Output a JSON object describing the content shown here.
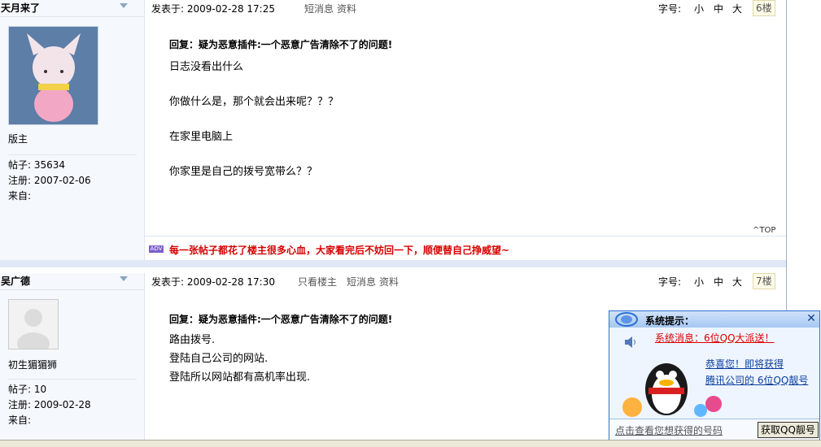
{
  "posts": [
    {
      "author": "天月来了",
      "rank": "版主",
      "stats": {
        "posts": "帖子: 35634",
        "reg": "注册:  2007-02-06",
        "from": "来自:"
      },
      "meta": {
        "posted": "发表于:  2009-02-28 17:25",
        "links": [
          "短消息",
          "资料"
        ]
      },
      "font": {
        "label": "字号:",
        "small": "小",
        "medium": "中",
        "large": "大"
      },
      "floor": "6楼",
      "reply_title": "回复：疑为恶意插件:一个恶意广告清除不了的问题!",
      "lines": [
        "日志没看出什么",
        "你做什么是，那个就会出来呢？？？",
        "在家里电脑上",
        "你家里是自己的拨号宽带么？？"
      ],
      "top": "TOP",
      "signature": "每一张帖子都花了楼主很多心血，大家看完后不妨回一下，顺便替自己挣威望~"
    },
    {
      "author": "吴广德",
      "rank": "初生猸猸狮",
      "stats": {
        "posts": "帖子: 10",
        "reg": "注册:  2009-02-28",
        "from": "来自:"
      },
      "meta": {
        "posted": "发表于:  2009-02-28 17:30",
        "links": [
          "只看楼主",
          "短消息",
          "资料"
        ]
      },
      "font": {
        "label": "字号:",
        "small": "小",
        "medium": "中",
        "large": "大"
      },
      "floor": "7楼",
      "reply_title": "回复：疑为恶意插件:一个恶意广告清除不了的问题!",
      "lines": [
        "路由拨号.",
        "登陆自己公司的网站.",
        "登陆所以网站都有高机率出现."
      ]
    }
  ],
  "popup": {
    "title": "系统提示：",
    "message": "系统消息：6位QQ大派送！",
    "line1": "恭喜您！即将获得",
    "line2": "腾讯公司的  6位QQ靓号",
    "hint": "点击查看您想获得的号码",
    "button": "获取QQ靓号",
    "close": "✕"
  },
  "icons": {
    "adv": "ADV"
  },
  "colors": {
    "signature": "#d60000",
    "accent": "#2b6fd8",
    "popup_link": "#0a3c9c"
  }
}
